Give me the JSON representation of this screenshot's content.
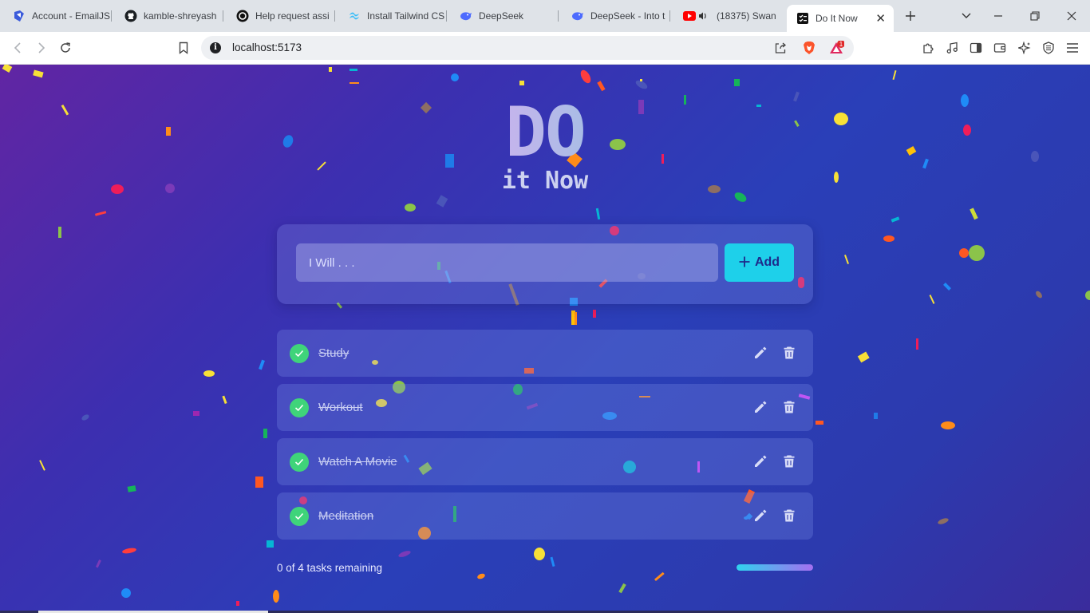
{
  "browser": {
    "tabs": [
      {
        "title": "Account - EmailJS",
        "icon": "emailjs-icon"
      },
      {
        "title": "kamble-shreyash",
        "icon": "github-icon"
      },
      {
        "title": "Help request assi",
        "icon": "openai-icon"
      },
      {
        "title": "Install Tailwind CS",
        "icon": "tailwind-icon"
      },
      {
        "title": "DeepSeek",
        "icon": "deepseek-icon"
      },
      {
        "title": "DeepSeek - Into t",
        "icon": "deepseek-icon"
      },
      {
        "title": "(18375) Swan",
        "icon": "youtube-icon"
      },
      {
        "title": "Do It Now",
        "icon": "app-icon",
        "active": true
      }
    ],
    "address": "localhost:5173",
    "brave_badge": "1"
  },
  "app": {
    "logo_main": "DO",
    "logo_sub": "it Now",
    "input_placeholder": "I Will . . .",
    "input_value": "",
    "add_label": "Add",
    "tasks": [
      {
        "label": "Study",
        "done": true
      },
      {
        "label": "Workout",
        "done": true
      },
      {
        "label": "Watch A Movie",
        "done": true
      },
      {
        "label": "Meditation",
        "done": true
      }
    ],
    "remaining_text": "0 of 4 tasks remaining",
    "progress_fraction": 1.0
  },
  "colors": {
    "accent": "#1ed0ea",
    "check": "#3fd47a",
    "progress_start": "#2fd3ee",
    "progress_end": "#a56ef0"
  }
}
